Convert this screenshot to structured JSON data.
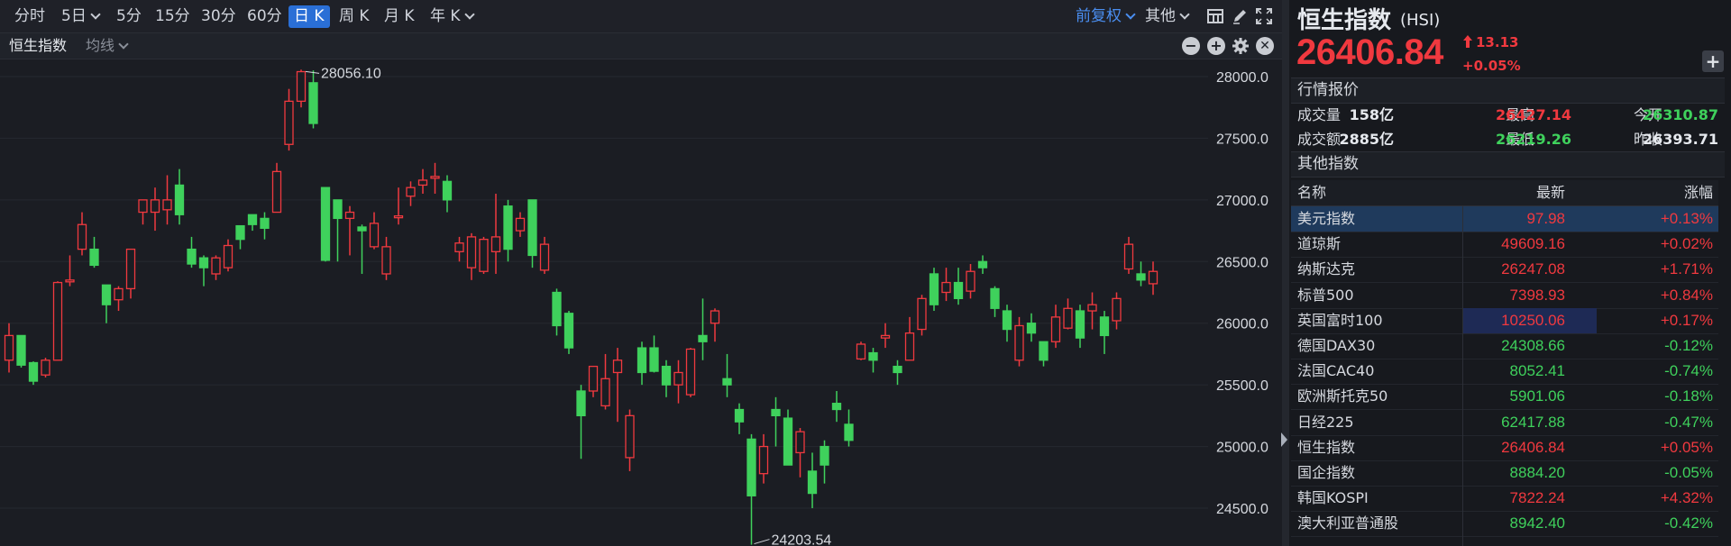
{
  "toolbar": {
    "periods": [
      {
        "label": "分时",
        "dropdown": false,
        "active": false
      },
      {
        "label": "5日",
        "dropdown": true,
        "active": false
      },
      {
        "label": "5分",
        "dropdown": false,
        "active": false
      },
      {
        "label": "15分",
        "dropdown": false,
        "active": false
      },
      {
        "label": "30分",
        "dropdown": false,
        "active": false
      },
      {
        "label": "60分",
        "dropdown": false,
        "active": false
      },
      {
        "label": "日 K",
        "dropdown": false,
        "active": true
      },
      {
        "label": "周 K",
        "dropdown": false,
        "active": false
      },
      {
        "label": "月 K",
        "dropdown": false,
        "active": false
      },
      {
        "label": "年 K",
        "dropdown": true,
        "active": false
      }
    ],
    "restore_label": "前复权",
    "other_label": "其他"
  },
  "subbar": {
    "symbol_label": "恒生指数",
    "ma_label": "均线"
  },
  "chart_data": {
    "type": "candlestick",
    "y_ticks": [
      "28000.0",
      "27500.0",
      "27000.0",
      "26500.0",
      "26000.0",
      "25500.0",
      "25000.0",
      "24500.0"
    ],
    "max_label": "28056.10",
    "min_label": "24203.54",
    "colors": {
      "up": "#f0393f",
      "down": "#3fd15c"
    },
    "candles": [
      [
        25700,
        25900,
        25600,
        26000
      ],
      [
        25900,
        25660,
        25640,
        25900
      ],
      [
        25680,
        25530,
        25500,
        25690
      ],
      [
        25580,
        25700,
        25560,
        25720
      ],
      [
        25700,
        26330,
        25700,
        26340
      ],
      [
        26350,
        26350,
        26300,
        26550
      ],
      [
        26600,
        26800,
        26550,
        26900
      ],
      [
        26600,
        26470,
        26450,
        26700
      ],
      [
        26310,
        26150,
        26000,
        26310
      ],
      [
        26190,
        26280,
        26100,
        26300
      ],
      [
        26280,
        26600,
        26200,
        26600
      ],
      [
        26900,
        27000,
        26800,
        27000
      ],
      [
        26900,
        27000,
        26750,
        27100
      ],
      [
        26920,
        27000,
        26800,
        27200
      ],
      [
        27120,
        26880,
        26800,
        27250
      ],
      [
        26600,
        26480,
        26450,
        26700
      ],
      [
        26530,
        26450,
        26300,
        26550
      ],
      [
        26400,
        26530,
        26350,
        26550
      ],
      [
        26450,
        26630,
        26420,
        26680
      ],
      [
        26790,
        26680,
        26600,
        26790
      ],
      [
        26880,
        26800,
        26750,
        26880
      ],
      [
        26850,
        26770,
        26680,
        26900
      ],
      [
        26900,
        27230,
        26900,
        27300
      ],
      [
        27450,
        27800,
        27400,
        27900
      ],
      [
        27800,
        28040,
        27750,
        28056.1
      ],
      [
        27950,
        27620,
        27580,
        28050
      ],
      [
        27100,
        26510,
        26500,
        27100
      ],
      [
        27000,
        26850,
        26500,
        27000
      ],
      [
        26850,
        26900,
        26550,
        26950
      ],
      [
        26780,
        26750,
        26400,
        26800
      ],
      [
        26620,
        26810,
        26600,
        26900
      ],
      [
        26400,
        26620,
        26350,
        26700
      ],
      [
        26860,
        26870,
        26800,
        27100
      ],
      [
        27030,
        27100,
        26950,
        27150
      ],
      [
        27120,
        27160,
        27050,
        27250
      ],
      [
        27180,
        27190,
        27050,
        27300
      ],
      [
        27150,
        27000,
        26900,
        27200
      ],
      [
        26580,
        26650,
        26500,
        26700
      ],
      [
        26450,
        26700,
        26350,
        26730
      ],
      [
        26420,
        26680,
        26400,
        26700
      ],
      [
        26580,
        26700,
        26400,
        27050
      ],
      [
        26950,
        26600,
        26500,
        27000
      ],
      [
        26750,
        26850,
        26700,
        26900
      ],
      [
        27000,
        26550,
        26450,
        27000
      ],
      [
        26430,
        26640,
        26400,
        26700
      ],
      [
        26250,
        25980,
        25900,
        26280
      ],
      [
        26080,
        25800,
        25750,
        26100
      ],
      [
        25450,
        25250,
        24900,
        25500
      ],
      [
        25450,
        25650,
        25400,
        25650
      ],
      [
        25330,
        25550,
        25300,
        25750
      ],
      [
        25600,
        25700,
        25200,
        25800
      ],
      [
        24910,
        25250,
        24800,
        25300
      ],
      [
        25800,
        25600,
        25500,
        25850
      ],
      [
        25800,
        25610,
        25600,
        25900
      ],
      [
        25650,
        25500,
        25400,
        25700
      ],
      [
        25500,
        25600,
        25350,
        25700
      ],
      [
        25420,
        25790,
        25400,
        25800
      ],
      [
        25900,
        25850,
        25700,
        26200
      ],
      [
        26000,
        26100,
        25850,
        26120
      ],
      [
        25550,
        25500,
        25400,
        25750
      ],
      [
        25300,
        25200,
        25100,
        25350
      ],
      [
        25060,
        24600,
        24203.54,
        25100
      ],
      [
        24780,
        25000,
        24700,
        25100
      ],
      [
        25300,
        25250,
        25000,
        25400
      ],
      [
        25230,
        24850,
        24850,
        25300
      ],
      [
        24950,
        25120,
        24750,
        25150
      ],
      [
        24800,
        24620,
        24500,
        24950
      ],
      [
        25000,
        24850,
        24700,
        25050
      ],
      [
        25350,
        25300,
        25200,
        25450
      ],
      [
        25180,
        25050,
        25000,
        25300
      ],
      [
        25710,
        25830,
        25700,
        25850
      ],
      [
        25760,
        25700,
        25600,
        25800
      ],
      [
        25880,
        25900,
        25800,
        26000
      ],
      [
        25650,
        25600,
        25500,
        25700
      ],
      [
        25700,
        25920,
        25700,
        26050
      ],
      [
        25950,
        26200,
        25900,
        26230
      ],
      [
        26400,
        26150,
        26100,
        26450
      ],
      [
        26250,
        26330,
        26180,
        26450
      ],
      [
        26330,
        26200,
        26150,
        26450
      ],
      [
        26260,
        26420,
        26200,
        26480
      ],
      [
        26500,
        26450,
        26400,
        26550
      ],
      [
        26280,
        26120,
        26050,
        26300
      ],
      [
        26100,
        25950,
        25850,
        26150
      ],
      [
        25700,
        25980,
        25650,
        26050
      ],
      [
        26000,
        25920,
        25850,
        26080
      ],
      [
        25850,
        25700,
        25650,
        25850
      ],
      [
        25850,
        26050,
        25800,
        26150
      ],
      [
        25960,
        26120,
        25950,
        26200
      ],
      [
        26100,
        25880,
        25800,
        26150
      ],
      [
        26100,
        26150,
        25950,
        26250
      ],
      [
        26050,
        25900,
        25750,
        26100
      ],
      [
        26020,
        26200,
        25950,
        26250
      ],
      [
        26440,
        26640,
        26400,
        26700
      ],
      [
        26400,
        26350,
        26300,
        26500
      ],
      [
        26320,
        26420,
        26230,
        26500
      ]
    ]
  },
  "quote": {
    "name": "恒生指数",
    "code": "(HSI)",
    "price": "26406.84",
    "change": "13.13",
    "change_pct": "+0.05%",
    "add_label": "+"
  },
  "market": {
    "title": "行情报价",
    "rows": [
      {
        "l1": "成交量",
        "v1": "158亿",
        "l2": "最高",
        "v2": "26427.14",
        "c2": "red",
        "l3": "今开",
        "v3": "26310.87",
        "c3": "green"
      },
      {
        "l1": "成交额",
        "v1": "2885亿",
        "l2": "最低",
        "v2": "26219.26",
        "c2": "green",
        "l3": "昨收",
        "v3": "26393.71",
        "c3": "plain"
      }
    ]
  },
  "other": {
    "title": "其他指数",
    "headers": {
      "name": "名称",
      "last": "最新",
      "pct": "涨幅"
    },
    "rows": [
      {
        "name": "美元指数",
        "last": "97.98",
        "pct": "+0.13%",
        "dir": "up",
        "selected": true
      },
      {
        "name": "道琼斯",
        "last": "49609.16",
        "pct": "+0.02%",
        "dir": "up"
      },
      {
        "name": "纳斯达克",
        "last": "26247.08",
        "pct": "+1.71%",
        "dir": "up"
      },
      {
        "name": "标普500",
        "last": "7398.93",
        "pct": "+0.84%",
        "dir": "up"
      },
      {
        "name": "英国富时100",
        "last": "10250.06",
        "pct": "+0.17%",
        "dir": "up",
        "highlight": true
      },
      {
        "name": "德国DAX30",
        "last": "24308.66",
        "pct": "-0.12%",
        "dir": "down"
      },
      {
        "name": "法国CAC40",
        "last": "8052.41",
        "pct": "-0.74%",
        "dir": "down"
      },
      {
        "name": "欧洲斯托克50",
        "last": "5901.06",
        "pct": "-0.18%",
        "dir": "down"
      },
      {
        "name": "日经225",
        "last": "62417.88",
        "pct": "-0.47%",
        "dir": "down"
      },
      {
        "name": "恒生指数",
        "last": "26406.84",
        "pct": "+0.05%",
        "dir": "up"
      },
      {
        "name": "国企指数",
        "last": "8884.20",
        "pct": "-0.05%",
        "dir": "down"
      },
      {
        "name": "韩国KOSPI",
        "last": "7822.24",
        "pct": "+4.32%",
        "dir": "up"
      },
      {
        "name": "澳大利亚普通股",
        "last": "8942.40",
        "pct": "-0.42%",
        "dir": "down"
      }
    ]
  },
  "icons": {
    "layout": "grid-layout-icon",
    "draw": "pen-icon",
    "fullscreen": "fullscreen-icon",
    "minus": "zoom-out-icon",
    "plus": "zoom-in-icon",
    "settings": "gear-icon",
    "close": "close-icon"
  }
}
